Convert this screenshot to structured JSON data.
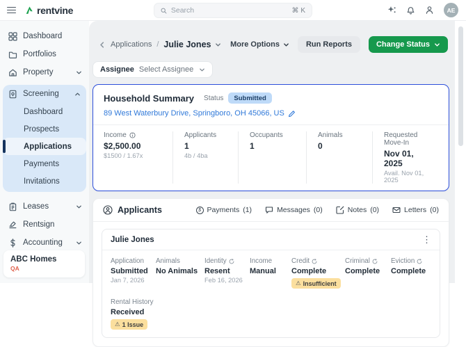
{
  "topbar": {
    "logo": "rentvine",
    "search_placeholder": "Search",
    "search_shortcut": "⌘ K",
    "avatar": "AE"
  },
  "sidebar": {
    "items": {
      "dashboard": "Dashboard",
      "portfolios": "Portfolios",
      "property": "Property",
      "screening": "Screening",
      "leases": "Leases",
      "rentsign": "Rentsign",
      "accounting": "Accounting"
    },
    "screening_children": {
      "dashboard": "Dashboard",
      "prospects": "Prospects",
      "applications": "Applications",
      "payments": "Payments",
      "invitations": "Invitations"
    },
    "account": {
      "name": "ABC Homes",
      "env": "QA"
    }
  },
  "header": {
    "breadcrumb_parent": "Applications",
    "breadcrumb_separator": "/",
    "breadcrumb_current": "Julie Jones",
    "more_options_label": "More Options",
    "run_reports_label": "Run Reports",
    "change_status_label": "Change Status"
  },
  "assignee": {
    "label": "Assignee",
    "value": "Select Assignee"
  },
  "household": {
    "title": "Household Summary",
    "status_label": "Status",
    "status_badge": "Submitted",
    "address": "89 West Waterbury Drive, Springboro, OH 45066, US",
    "stats": [
      {
        "label": "Income",
        "value": "$2,500.00",
        "sub": "$1500 / 1.67x"
      },
      {
        "label": "Applicants",
        "value": "1",
        "sub": "4b / 4ba"
      },
      {
        "label": "Occupants",
        "value": "1",
        "sub": ""
      },
      {
        "label": "Animals",
        "value": "0",
        "sub": ""
      },
      {
        "label": "Requested Move-In",
        "value": "Nov 01, 2025",
        "sub": "Avail. Nov 01, 2025"
      }
    ]
  },
  "applicants": {
    "title": "Applicants",
    "tabs": [
      {
        "label": "Payments",
        "count": "(1)"
      },
      {
        "label": "Messages",
        "count": "(0)"
      },
      {
        "label": "Notes",
        "count": "(0)"
      },
      {
        "label": "Letters",
        "count": "(0)"
      }
    ],
    "applicant": {
      "name": "Julie Jones",
      "checks": [
        {
          "label": "Application",
          "value": "Submitted",
          "sub": "Jan 7, 2026"
        },
        {
          "label": "Animals",
          "value": "No Animals",
          "sub": ""
        },
        {
          "label": "Identity",
          "value": "Resent",
          "sub": "Feb 16, 2026"
        },
        {
          "label": "Income",
          "value": "Manual",
          "sub": ""
        },
        {
          "label": "Credit",
          "value": "Complete",
          "badge": "Insufficient"
        },
        {
          "label": "Criminal",
          "value": "Complete",
          "sub": ""
        },
        {
          "label": "Eviction",
          "value": "Complete",
          "sub": ""
        },
        {
          "label": "Rental History",
          "value": "Received",
          "badge": "1 Issue"
        }
      ]
    }
  },
  "icons": {
    "warning": "⚠",
    "kebab": "⋮",
    "dollar": "$"
  },
  "colors": {
    "brand_green": "#16994d",
    "selection_blue": "#2d4fdb",
    "link_blue": "#3079d9",
    "badge_blue_bg": "#bedaf8",
    "badge_warn_bg": "#fbdf9e",
    "active_navy": "#16345e",
    "env_red": "#df604b"
  }
}
